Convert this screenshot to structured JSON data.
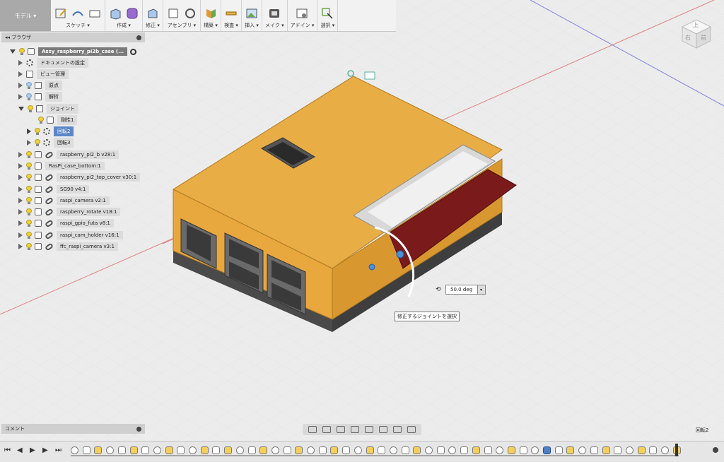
{
  "toolbar": {
    "mode": "モデル ▾",
    "groups": [
      {
        "label": "スケッチ ▾"
      },
      {
        "label": "作成 ▾"
      },
      {
        "label": "修正 ▾"
      },
      {
        "label": "アセンブリ ▾"
      },
      {
        "label": "構築 ▾"
      },
      {
        "label": "検査 ▾"
      },
      {
        "label": "挿入 ▾"
      },
      {
        "label": "メイク ▾"
      },
      {
        "label": "アドイン ▾"
      },
      {
        "label": "選択 ▾"
      }
    ]
  },
  "browser": {
    "title": "ブラウザ",
    "collapse": "◂◂",
    "items": [
      {
        "label": "Assy_raspberry_pi2b_case (..."
      },
      {
        "label": "ドキュメントの設定"
      },
      {
        "label": "ビュー管理"
      },
      {
        "label": "原点"
      },
      {
        "label": "解析"
      },
      {
        "label": "ジョイント"
      },
      {
        "label": "剛性1"
      },
      {
        "label": "回転2"
      },
      {
        "label": "回転3"
      },
      {
        "label": "raspberry_pi2_b v28:1"
      },
      {
        "label": "RasPi_case_bottom:1"
      },
      {
        "label": "raspberry_pi2_top_cover v30:1"
      },
      {
        "label": "SG90 v4:1"
      },
      {
        "label": "raspi_camera v2:1"
      },
      {
        "label": "raspberry_rotate v18:1"
      },
      {
        "label": "raspi_gpio_futa v8:1"
      },
      {
        "label": "raspi_cam_holder v16:1"
      },
      {
        "label": "ffc_raspi_camera v3:1"
      }
    ]
  },
  "comment": {
    "title": "コメント"
  },
  "viewcube": {
    "face_top": "上",
    "face_right": "右",
    "face_front": "前"
  },
  "dimension": {
    "value": "50.0 deg",
    "dropdown": "▾"
  },
  "tooltip": "修正するジョイントを選択",
  "status": "回転2",
  "colors": {
    "case_body": "#e8a83e",
    "case_base": "#5a5a5a",
    "selection": "#5b87c7",
    "lid": "#7a1a1a"
  }
}
